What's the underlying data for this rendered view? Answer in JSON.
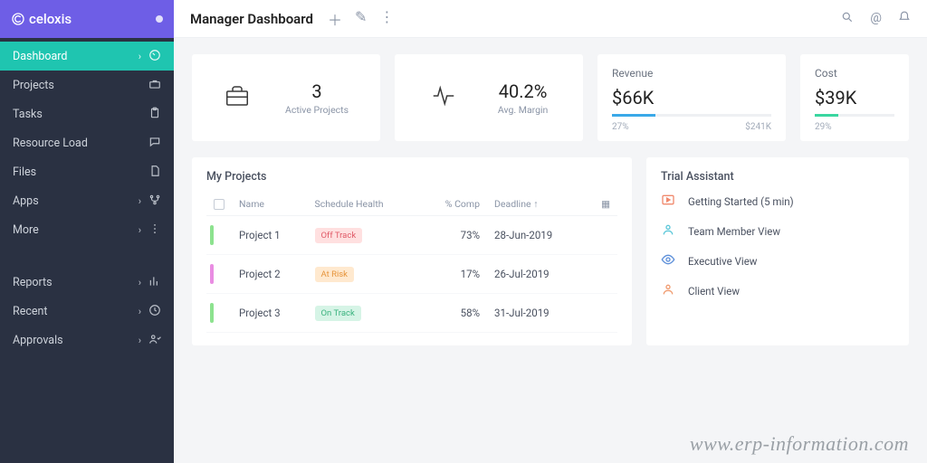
{
  "brand": "celoxis",
  "sidebar": {
    "items": [
      {
        "label": "Dashboard",
        "hasChevron": true,
        "icon": "gauge",
        "active": true
      },
      {
        "label": "Projects",
        "hasChevron": false,
        "icon": "briefcase"
      },
      {
        "label": "Tasks",
        "hasChevron": false,
        "icon": "clipboard"
      },
      {
        "label": "Resource Load",
        "hasChevron": false,
        "icon": "message"
      },
      {
        "label": "Files",
        "hasChevron": false,
        "icon": "file"
      },
      {
        "label": "Apps",
        "hasChevron": true,
        "icon": "branch"
      },
      {
        "label": "More",
        "hasChevron": true,
        "icon": "dots"
      }
    ],
    "items2": [
      {
        "label": "Reports",
        "hasChevron": true,
        "icon": "chart"
      },
      {
        "label": "Recent",
        "hasChevron": true,
        "icon": "clock"
      },
      {
        "label": "Approvals",
        "hasChevron": true,
        "icon": "user-check"
      }
    ]
  },
  "header": {
    "title": "Manager Dashboard"
  },
  "stats": {
    "projects_count": "3",
    "projects_label": "Active Projects",
    "margin_value": "40.2%",
    "margin_label": "Avg. Margin"
  },
  "kpi": {
    "revenue": {
      "label": "Revenue",
      "value": "$66K",
      "pct_text": "27%",
      "pct": 27,
      "right_text": "$241K"
    },
    "cost": {
      "label": "Cost",
      "value": "$39K",
      "pct_text": "29%",
      "pct": 29,
      "right_text": ""
    }
  },
  "projects_panel": {
    "title": "My Projects",
    "columns": {
      "name": "Name",
      "health": "Schedule Health",
      "comp": "% Comp",
      "deadline": "Deadline"
    },
    "rows": [
      {
        "name": "Project 1",
        "health": "Off Track",
        "health_cls": "off",
        "comp": "73%",
        "deadline": "28-Jun-2019",
        "bar": "g"
      },
      {
        "name": "Project 2",
        "health": "At Risk",
        "health_cls": "risk",
        "comp": "17%",
        "deadline": "26-Jul-2019",
        "bar": "p"
      },
      {
        "name": "Project 3",
        "health": "On Track",
        "health_cls": "on",
        "comp": "58%",
        "deadline": "31-Jul-2019",
        "bar": "g"
      }
    ]
  },
  "assistant": {
    "title": "Trial Assistant",
    "items": [
      {
        "label": "Getting Started (5 min)",
        "color": "#f08a6e"
      },
      {
        "label": "Team Member View",
        "color": "#5bc7d9"
      },
      {
        "label": "Executive View",
        "color": "#5b8ed9"
      },
      {
        "label": "Client View",
        "color": "#f09a6e"
      }
    ]
  },
  "watermark": "www.erp-information.com"
}
